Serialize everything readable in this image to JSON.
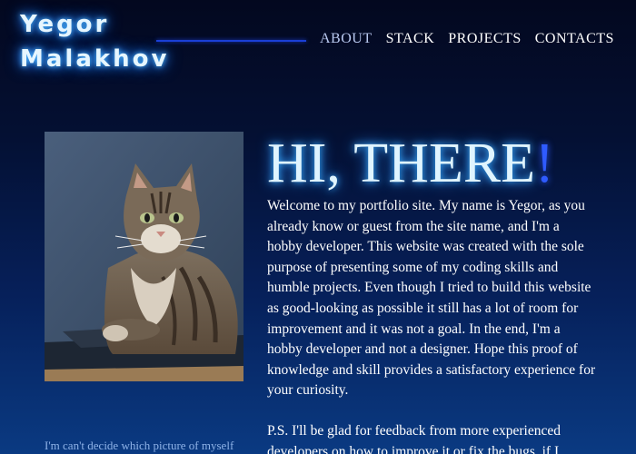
{
  "logo": {
    "first": "Yegor",
    "last": "Malakhov"
  },
  "nav": {
    "items": [
      {
        "label": "ABOUT",
        "active": true
      },
      {
        "label": "STACK",
        "active": false
      },
      {
        "label": "PROJECTS",
        "active": false
      },
      {
        "label": "CONTACTS",
        "active": false
      }
    ]
  },
  "hero": {
    "title": "HI, THERE",
    "exclamation": "!",
    "paragraph": "Welcome to my portfolio site. My name is Yegor, as you already know or guest from the site name, and I'm a hobby developer. This website was created with the sole purpose of presenting some of my coding skills and humble projects. Even though I tried to build this website as good-looking as possible it still has a lot of room for improvement and it was not a goal. In the end, I'm a hobby developer and not a designer. Hope this proof of knowledge and skill provides a satisfactory experience for your curiosity.",
    "ps": "P.S. I'll be glad for feedback from more experienced developers on how to improve it or fix the bugs, if I"
  },
  "photo": {
    "caption": "I'm can't decide which picture of myself"
  },
  "colors": {
    "accent": "#2f5bff",
    "glow": "#3aaeff",
    "background_top": "#03081f",
    "background_bottom": "#0a3a82"
  }
}
